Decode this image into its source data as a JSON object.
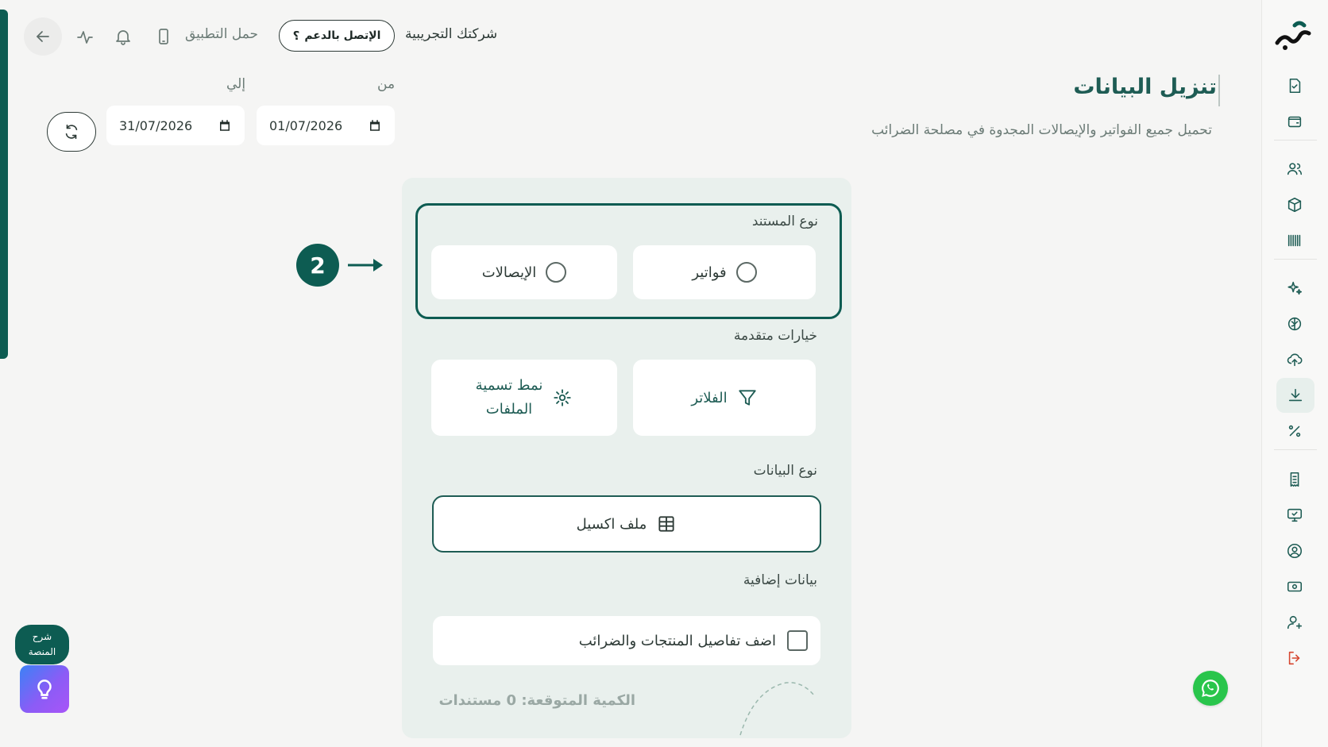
{
  "topbar": {
    "company_name": "شركتك التجريبية",
    "support_label": "الإتصل بالدعم",
    "download_app_label": "حمل التطبيق"
  },
  "header": {
    "title": "تنزيل البيانات",
    "subtitle": "تحميل جميع الفواتير والإيصالات المجدوة في مصلحة الضرائب"
  },
  "date_range": {
    "from_label": "من",
    "from_value": "01/07/2026",
    "to_label": "إلي",
    "to_value": "31/07/2026"
  },
  "form": {
    "document_type_label": "نوع المستند",
    "document_types": [
      {
        "label": "فواتير",
        "selected": false
      },
      {
        "label": "الإيصالات",
        "selected": false
      }
    ],
    "advanced_label": "خيارات متقدمة",
    "filters_label": "الفلاتر",
    "naming_line1": "نمط تسمية",
    "naming_line2": "الملفات",
    "data_type_label": "نوع البيانات",
    "excel_label": "ملف اكسيل",
    "extra_label": "بيانات إضافية",
    "extra_checkbox_label": "اضف تفاصيل المنتجات والضرائب",
    "extra_checked": false,
    "expected_count": "الكمية المتوقعة: 0 مستندات"
  },
  "step": {
    "number": "2"
  },
  "widgets": {
    "explain_line1": "شرح",
    "explain_line2": "المنصة"
  },
  "icons": {
    "sidebar": [
      "logo",
      "document-check-icon",
      "wallet-icon",
      "users-icon",
      "box-icon",
      "barcode-icon",
      "sparkle-icon",
      "brain-icon",
      "cloud-upload-icon",
      "download-icon",
      "percent-icon",
      "receipt-icon",
      "monitor-check-icon",
      "user-circle-icon",
      "cash-icon",
      "user-add-icon",
      "logout-icon"
    ],
    "active": "download-icon"
  },
  "colors": {
    "brand": "#0d5c52",
    "panel": "#e9f0ed",
    "logout": "#d6452e",
    "whatsapp": "#29c54b"
  }
}
